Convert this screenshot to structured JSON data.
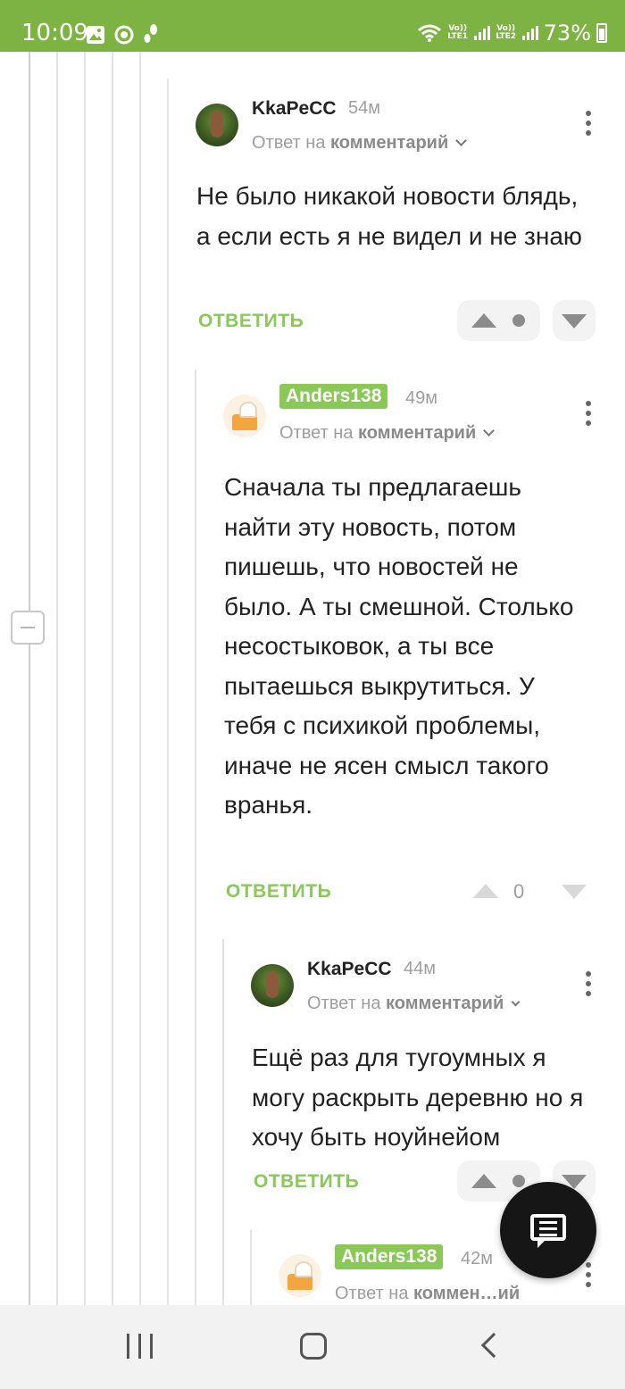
{
  "status_bar": {
    "time": "10:09",
    "sim1": "Vo)) LTE1",
    "sim2": "Vo)) LTE2",
    "battery": "73%",
    "bg_color": "#7cb342"
  },
  "labels": {
    "reply_to": "Ответ на",
    "reply_target": "комментарий",
    "reply_target_truncated": "коммен…ий",
    "reply_button": "ОТВЕТИТЬ"
  },
  "comments": [
    {
      "user": "KkaPeCC",
      "time": "54м",
      "avatar": "green-avatar",
      "text": "Не было никакой новости блядь, а если есть я не видел и не знаю"
    },
    {
      "user": "Anders138",
      "time": "49м",
      "avatar": "cake-avatar",
      "text": "Сначала ты предлагаешь найти эту новость, потом пишешь, что новостей не было. А ты смешной. Столько несостыковок, а ты все пытаешься выкрутиться. У тебя с психикой проблемы, иначе не ясен смысл такого вранья.",
      "rating": "0"
    },
    {
      "user": "KkaPeCC",
      "time": "44м",
      "avatar": "green-avatar",
      "text": "Ещё раз для тугоумных я могу раскрыть деревню но я хочу быть ноуйнейом"
    },
    {
      "user": "Anders138",
      "time": "42м",
      "avatar": "cake-avatar"
    }
  ],
  "accent_color": "#8ac858",
  "icons": {
    "fab": "chat-icon",
    "collapse": "minus-icon"
  }
}
